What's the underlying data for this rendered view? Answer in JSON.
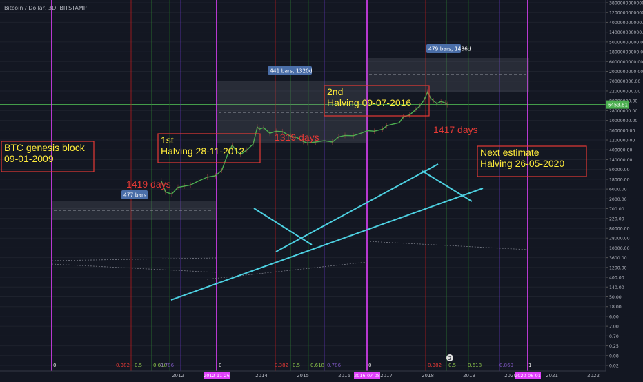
{
  "chart_data": {
    "type": "line",
    "title": "Bitcoin / Dollar, 3D, BITSTAMP",
    "y_scale": "log",
    "ylim": [
      0.02,
      3800000000000
    ],
    "y_ticks": [
      "3800000000000.00",
      "1200000000000.00",
      "400000000000.00",
      "140000000000.00",
      "50000000000.00",
      "18000000000.00",
      "6000000000.00",
      "2000000000.00",
      "700000000.00",
      "220000000.00",
      "80000000.00",
      "28000000.00",
      "10000000.00",
      "3600000.00",
      "1200000.00",
      "400000.00",
      "140000.00",
      "50000.00",
      "18000.00",
      "6000.00",
      "2000.00",
      "700.00",
      "220.00",
      "80000.00",
      "28000.00",
      "10000.00",
      "3600.00",
      "1200.00",
      "400.00",
      "140.00",
      "50.00",
      "18.00",
      "6.00",
      "2.00",
      "0.70",
      "0.25",
      "0.08",
      "0.02"
    ],
    "x_ticks": [
      "2012",
      "2014",
      "2015",
      "2016",
      "2017",
      "2018",
      "2019",
      "2021",
      "2022"
    ],
    "halving_date_labels": [
      "2012-11-26",
      "2016-07-08",
      "2020-06-01"
    ],
    "partial_x_label": "2020",
    "price_label": "6453.81",
    "series": [
      {
        "values": [
          [
            2011.6,
            8
          ],
          [
            2011.7,
            3
          ],
          [
            2011.85,
            2.5
          ],
          [
            2012.0,
            4.5
          ],
          [
            2012.15,
            5
          ],
          [
            2012.3,
            5.5
          ],
          [
            2012.5,
            8
          ],
          [
            2012.7,
            11
          ],
          [
            2012.9,
            12.5
          ],
          [
            2013.05,
            20
          ],
          [
            2013.2,
            90
          ],
          [
            2013.3,
            180
          ],
          [
            2013.4,
            110
          ],
          [
            2013.5,
            80
          ],
          [
            2013.65,
            120
          ],
          [
            2013.8,
            200
          ],
          [
            2013.9,
            900
          ],
          [
            2013.95,
            750
          ],
          [
            2014.05,
            850
          ],
          [
            2014.2,
            520
          ],
          [
            2014.35,
            620
          ],
          [
            2014.5,
            600
          ],
          [
            2014.7,
            400
          ],
          [
            2014.85,
            360
          ],
          [
            2015.0,
            250
          ],
          [
            2015.1,
            220
          ],
          [
            2015.3,
            240
          ],
          [
            2015.5,
            270
          ],
          [
            2015.7,
            240
          ],
          [
            2015.85,
            380
          ],
          [
            2016.0,
            430
          ],
          [
            2016.2,
            420
          ],
          [
            2016.4,
            530
          ],
          [
            2016.55,
            650
          ],
          [
            2016.7,
            620
          ],
          [
            2016.9,
            740
          ],
          [
            2017.0,
            1000
          ],
          [
            2017.15,
            1150
          ],
          [
            2017.3,
            1300
          ],
          [
            2017.4,
            2200
          ],
          [
            2017.55,
            2600
          ],
          [
            2017.7,
            4200
          ],
          [
            2017.8,
            5800
          ],
          [
            2017.9,
            10000
          ],
          [
            2017.98,
            19500
          ],
          [
            2018.05,
            11500
          ],
          [
            2018.12,
            9000
          ],
          [
            2018.2,
            7000
          ],
          [
            2018.3,
            8500
          ],
          [
            2018.4,
            7500
          ],
          [
            2018.45,
            6453.81
          ]
        ]
      }
    ],
    "annotations": {
      "genesis": [
        "BTC genesis block",
        "09-01-2009"
      ],
      "halving1": [
        "1st",
        "Halving 28-11-2012"
      ],
      "halving2": [
        "2nd",
        "Halving  09-07-2016"
      ],
      "next": [
        "Next estimate",
        "Halving  26-05-2020"
      ],
      "days": [
        "1419 days",
        "1319 days",
        "1417 days"
      ],
      "bars": [
        "477 bars",
        "441 bars, 1320d",
        "479 bars, 1436d"
      ],
      "fib_row": [
        "0",
        "0.382",
        "0.5",
        "0.618",
        "0.786",
        "0",
        "0.382",
        "0.5",
        "0.618",
        "0.786",
        "0",
        "0.382",
        "0.5",
        "0.618",
        "0.869",
        "1"
      ]
    },
    "flag_count": "2",
    "colors": {
      "background": "#131722",
      "candles": "#4caf50",
      "trendlines": "#4dd0e1",
      "halving_lines": "#e040fb",
      "annotation_border": "#e53935",
      "annotation_text": "#ffeb3b",
      "days_text": "#e53935",
      "price_line": "#4caf50"
    }
  }
}
